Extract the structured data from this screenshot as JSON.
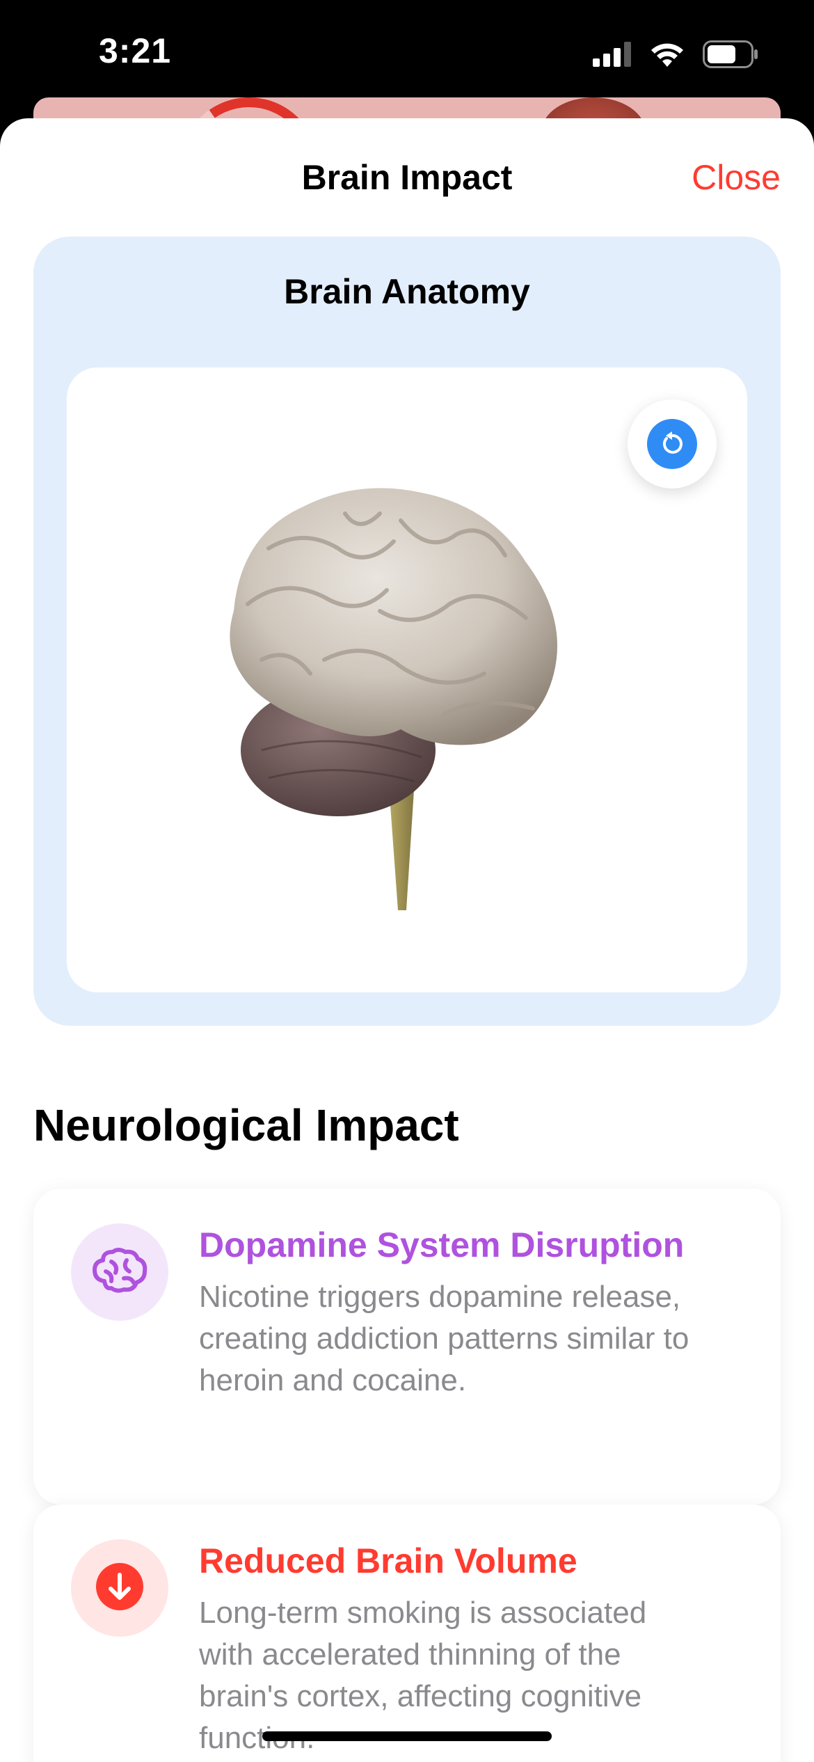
{
  "status_bar": {
    "time": "3:21",
    "icons": [
      "cellular-signal-icon",
      "wifi-icon",
      "battery-icon"
    ]
  },
  "sheet": {
    "title": "Brain Impact",
    "close_label": "Close"
  },
  "anatomy": {
    "title": "Brain Anatomy",
    "reset_icon": "rotate-reset-icon"
  },
  "section": {
    "heading": "Neurological Impact"
  },
  "impacts": [
    {
      "icon": "brain-icon",
      "title": "Dopamine System Disruption",
      "description": "Nicotine triggers dopamine release, creating addiction patterns similar to heroin and cocaine.",
      "accent_color": "#af52de",
      "icon_bg": "#f3e6fb"
    },
    {
      "icon": "arrow-down-circle-icon",
      "title": "Reduced Brain Volume",
      "description": "Long-term smoking is associated with accelerated thinning of the brain's cortex, affecting cognitive function.",
      "accent_color": "#ff3b30",
      "icon_bg": "#ffe5e4"
    }
  ],
  "colors": {
    "close": "#ff3b30",
    "anatomy_bg": "#e3eefc",
    "reset_accent": "#2f8cf4"
  }
}
